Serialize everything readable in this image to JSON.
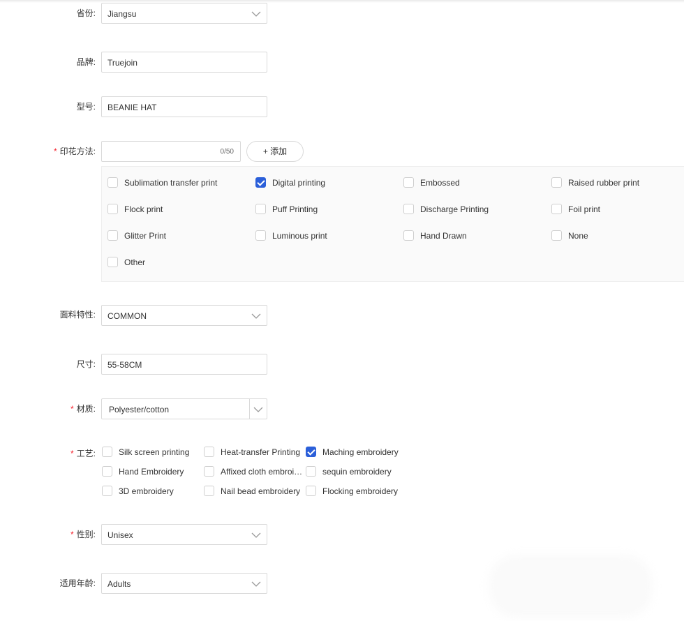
{
  "fields": {
    "province": {
      "label": "省份:",
      "value": "Jiangsu"
    },
    "brand": {
      "label": "品牌:",
      "value": "Truejoin"
    },
    "model": {
      "label": "型号:",
      "value": "BEANIE HAT"
    },
    "print_method": {
      "label": "印花方法:",
      "required": "*",
      "value": "",
      "counter": "0/50",
      "add_button": "+ 添加"
    },
    "fabric": {
      "label": "面料特性:",
      "value": "COMMON"
    },
    "size": {
      "label": "尺寸:",
      "value": "55-58CM"
    },
    "material": {
      "label": "材质:",
      "required": "*",
      "value": "Polyester/cotton"
    },
    "craft": {
      "label": "工艺:",
      "required": "*"
    },
    "gender": {
      "label": "性别:",
      "required": "*",
      "value": "Unisex"
    },
    "age": {
      "label": "适用年龄:",
      "value": "Adults"
    }
  },
  "print_options": [
    {
      "label": "Sublimation transfer print",
      "checked": false
    },
    {
      "label": "Digital printing",
      "checked": true
    },
    {
      "label": "Embossed",
      "checked": false
    },
    {
      "label": "Raised rubber print",
      "checked": false
    },
    {
      "label": "Flock print",
      "checked": false
    },
    {
      "label": "Puff Printing",
      "checked": false
    },
    {
      "label": "Discharge Printing",
      "checked": false
    },
    {
      "label": "Foil print",
      "checked": false
    },
    {
      "label": "Glitter Print",
      "checked": false
    },
    {
      "label": "Luminous print",
      "checked": false
    },
    {
      "label": "Hand Drawn",
      "checked": false
    },
    {
      "label": "None",
      "checked": false
    },
    {
      "label": "Other",
      "checked": false
    }
  ],
  "craft_options": [
    {
      "label": "Silk screen printing",
      "checked": false
    },
    {
      "label": "Heat-transfer Printing",
      "checked": false
    },
    {
      "label": "Maching embroidery",
      "checked": true
    },
    {
      "label": "Hand Embroidery",
      "checked": false
    },
    {
      "label": "Affixed cloth embroi…",
      "checked": false
    },
    {
      "label": "sequin embroidery",
      "checked": false
    },
    {
      "label": "3D embroidery",
      "checked": false
    },
    {
      "label": "Nail bead embroidery",
      "checked": false
    },
    {
      "label": "Flocking embroidery",
      "checked": false
    }
  ],
  "colors": {
    "accent": "#2b5fd9",
    "required": "#f5222d",
    "border": "#d9d9d9"
  },
  "icons": {
    "select_arrow": "chevron-down-icon",
    "check": "check-icon"
  }
}
